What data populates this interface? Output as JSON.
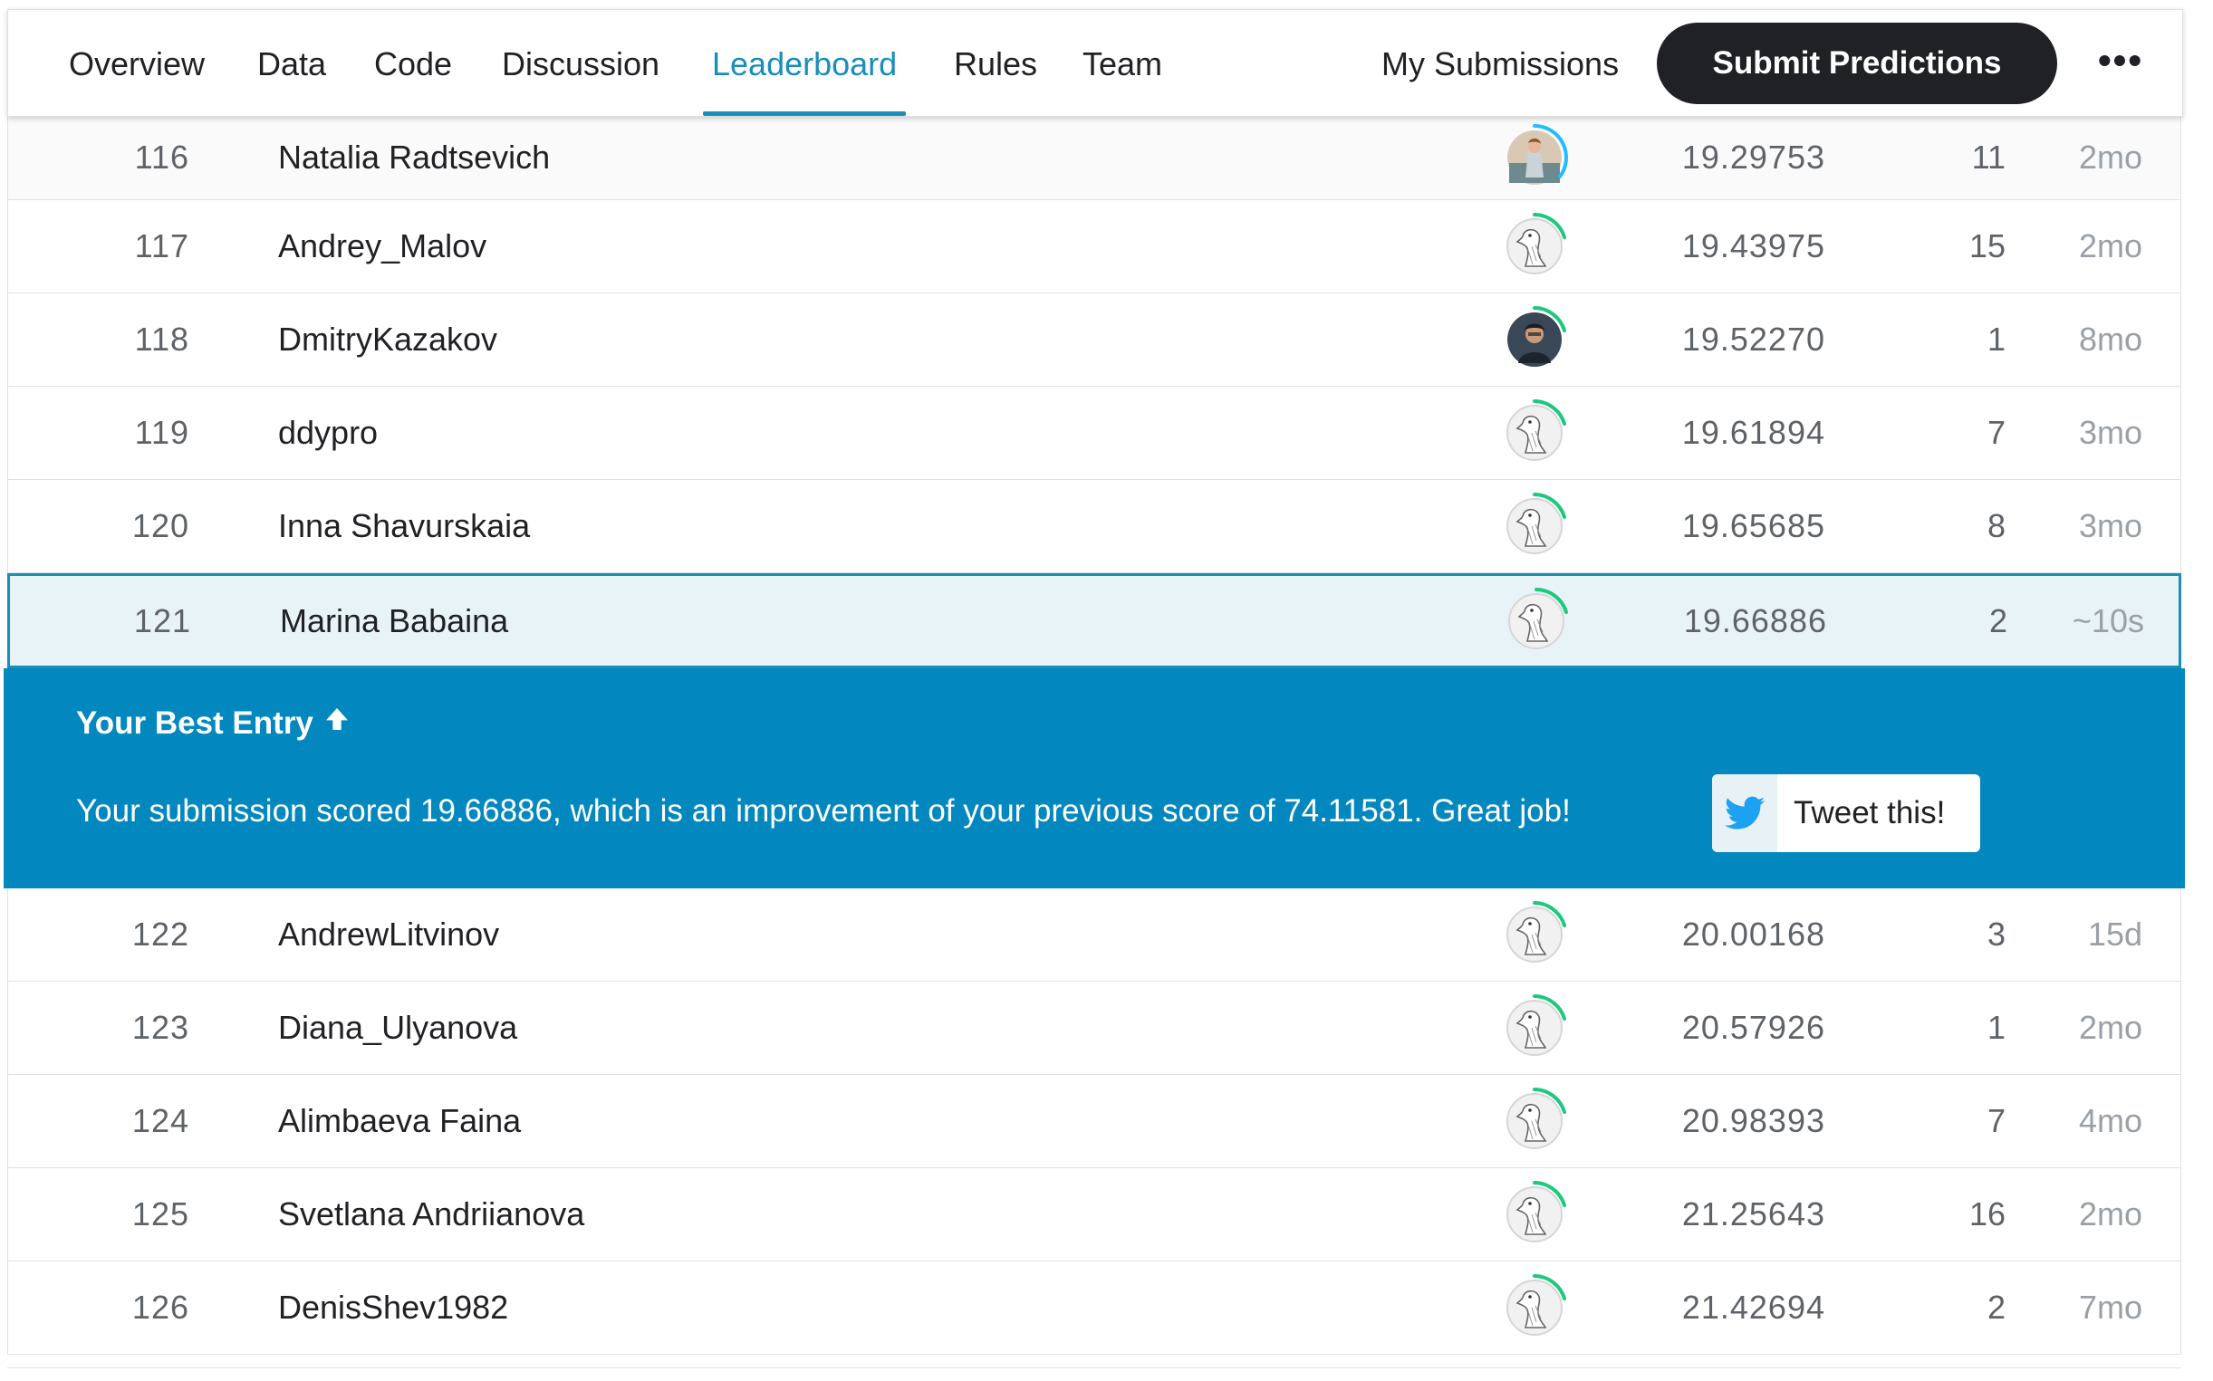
{
  "nav": {
    "tabs": [
      {
        "label": "Overview"
      },
      {
        "label": "Data"
      },
      {
        "label": "Code"
      },
      {
        "label": "Discussion"
      },
      {
        "label": "Leaderboard",
        "active": true
      },
      {
        "label": "Rules"
      },
      {
        "label": "Team"
      }
    ],
    "my_submissions": "My Submissions",
    "submit_button": "Submit Predictions",
    "more_icon": "more-horizontal-icon",
    "more_label": "•••"
  },
  "colors": {
    "accent": "#1a8dbb",
    "banner": "#0288bf",
    "progress_green": "#20beff",
    "progress_ring": "#1ec97e"
  },
  "rows_before": [
    {
      "rank": "116",
      "name": "Natalia Radtsevich",
      "score": "19.29753",
      "entries": "11",
      "last": "2mo",
      "avatar": "photo-woman"
    },
    {
      "rank": "117",
      "name": "Andrey_Malov",
      "score": "19.43975",
      "entries": "15",
      "last": "2mo",
      "avatar": "default-goose"
    },
    {
      "rank": "118",
      "name": "DmitryKazakov",
      "score": "19.52270",
      "entries": "1",
      "last": "8mo",
      "avatar": "photo-man"
    },
    {
      "rank": "119",
      "name": "ddypro",
      "score": "19.61894",
      "entries": "7",
      "last": "3mo",
      "avatar": "default-goose"
    },
    {
      "rank": "120",
      "name": "Inna Shavurskaia",
      "score": "19.65685",
      "entries": "8",
      "last": "3mo",
      "avatar": "default-goose"
    }
  ],
  "highlight_row": {
    "rank": "121",
    "name": "Marina Babaina",
    "score": "19.66886",
    "entries": "2",
    "last": "~10s",
    "avatar": "default-goose"
  },
  "best_entry": {
    "title": "Your Best Entry",
    "arrow_icon": "arrow-up-icon",
    "message": "Your submission scored 19.66886, which is an improvement of your previous score of 74.11581. Great job!",
    "tweet_label": "Tweet this!",
    "tweet_icon": "twitter-icon"
  },
  "rows_after": [
    {
      "rank": "122",
      "name": "AndrewLitvinov",
      "score": "20.00168",
      "entries": "3",
      "last": "15d",
      "avatar": "default-goose"
    },
    {
      "rank": "123",
      "name": "Diana_Ulyanova",
      "score": "20.57926",
      "entries": "1",
      "last": "2mo",
      "avatar": "default-goose"
    },
    {
      "rank": "124",
      "name": "Alimbaeva Faina",
      "score": "20.98393",
      "entries": "7",
      "last": "4mo",
      "avatar": "default-goose"
    },
    {
      "rank": "125",
      "name": "Svetlana Andriianova",
      "score": "21.25643",
      "entries": "16",
      "last": "2mo",
      "avatar": "default-goose"
    },
    {
      "rank": "126",
      "name": "DenisShev1982",
      "score": "21.42694",
      "entries": "2",
      "last": "7mo",
      "avatar": "default-goose"
    }
  ]
}
